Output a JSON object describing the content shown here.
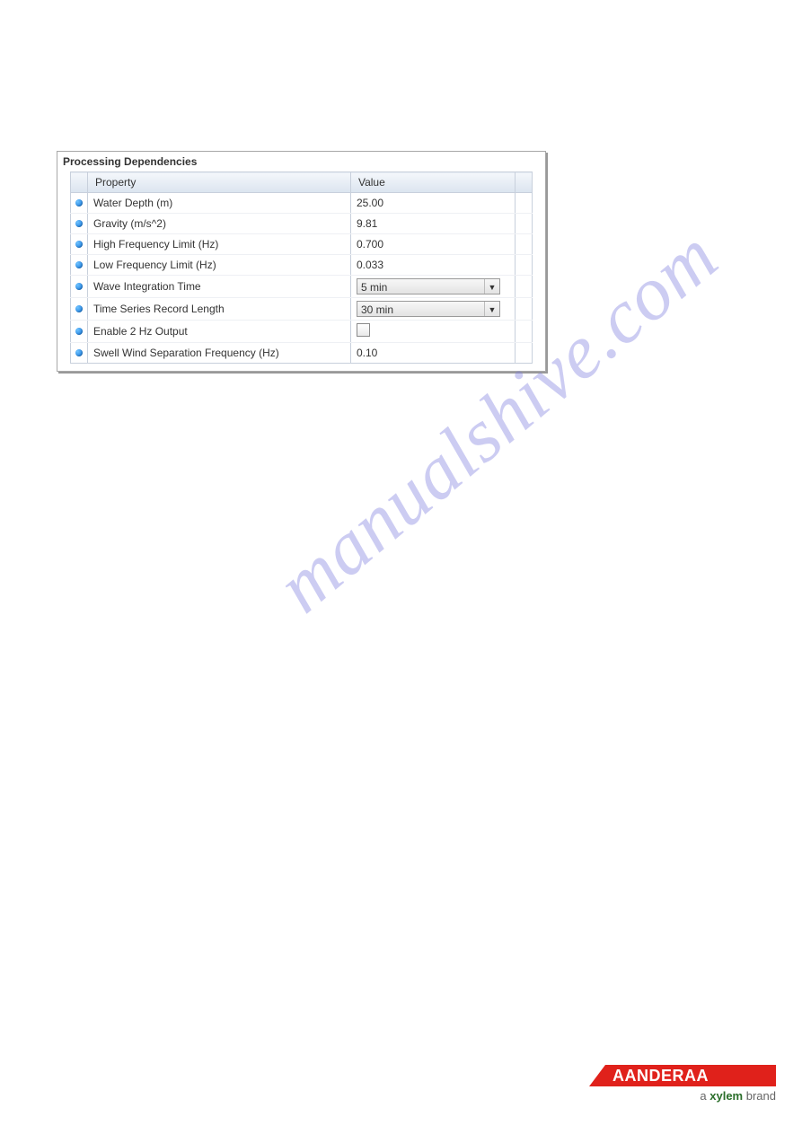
{
  "panel": {
    "title": "Processing Dependencies",
    "headers": {
      "property": "Property",
      "value": "Value"
    },
    "rows": [
      {
        "label": "Water Depth (m)",
        "kind": "text",
        "value": "25.00"
      },
      {
        "label": "Gravity (m/s^2)",
        "kind": "text",
        "value": "9.81"
      },
      {
        "label": "High Frequency Limit (Hz)",
        "kind": "text",
        "value": "0.700"
      },
      {
        "label": "Low Frequency Limit (Hz)",
        "kind": "text",
        "value": "0.033"
      },
      {
        "label": "Wave Integration Time",
        "kind": "dropdown",
        "value": "5 min"
      },
      {
        "label": "Time Series Record Length",
        "kind": "dropdown",
        "value": "30 min"
      },
      {
        "label": "Enable 2 Hz Output",
        "kind": "checkbox",
        "value": ""
      },
      {
        "label": "Swell Wind Separation Frequency (Hz)",
        "kind": "text",
        "value": "0.10"
      }
    ]
  },
  "watermark": "manualshive.com",
  "brand": {
    "name": "AANDERAA",
    "tag_prefix": "a ",
    "tag_bold": "xylem",
    "tag_suffix": " brand"
  }
}
